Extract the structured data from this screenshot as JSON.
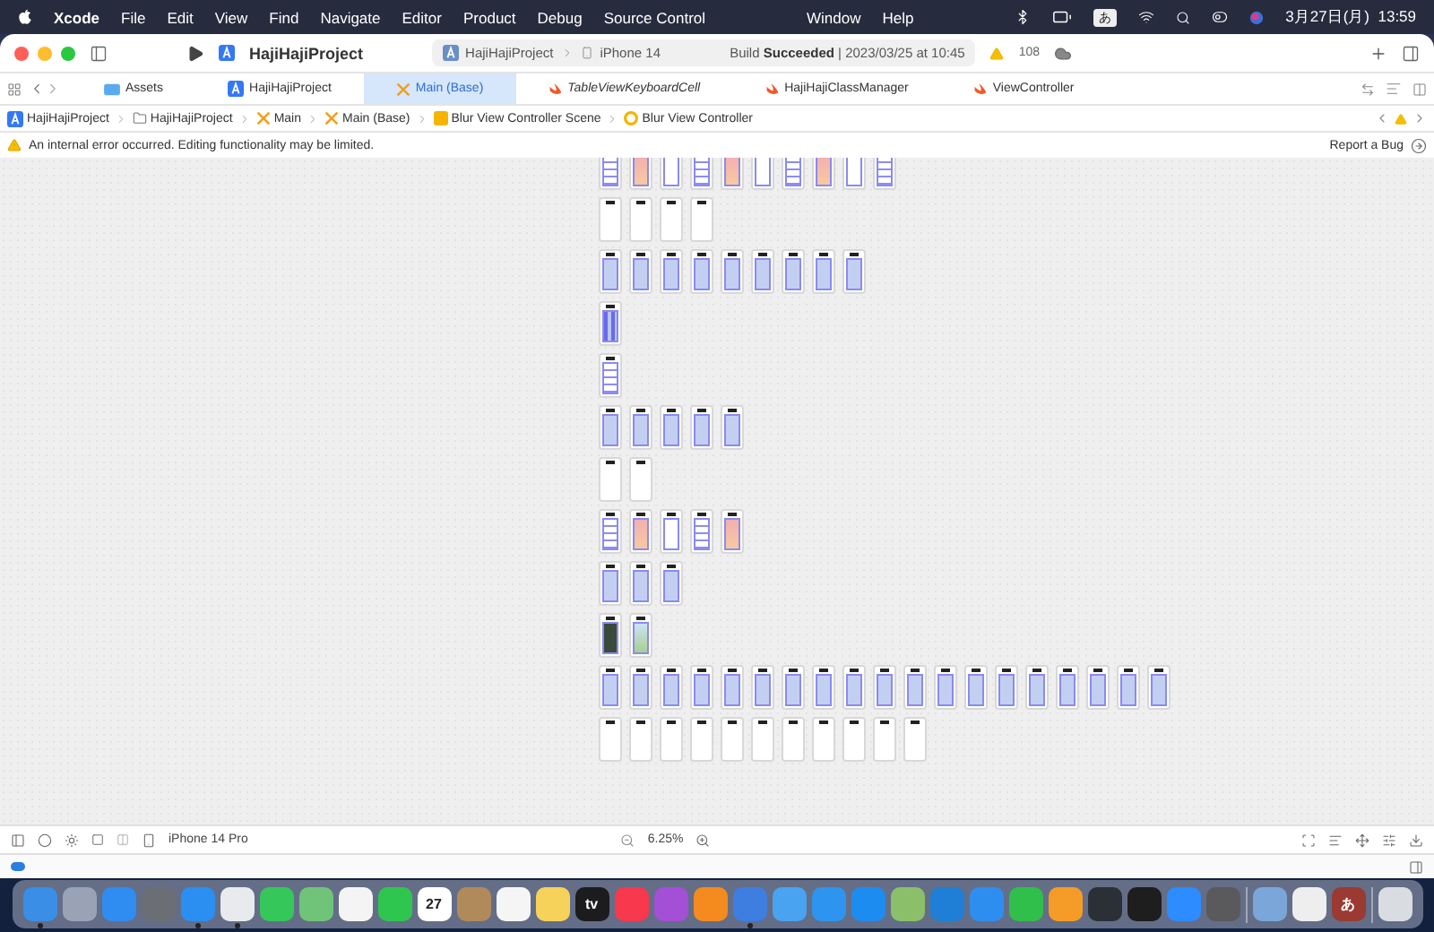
{
  "menu_bar": {
    "app": "Xcode",
    "menus": [
      "File",
      "Edit",
      "View",
      "Find",
      "Navigate",
      "Editor",
      "Product",
      "Debug",
      "Source Control"
    ],
    "right_menus": [
      "Window",
      "Help"
    ],
    "input_mode": "あ",
    "clock": "3月27日(月)  13:59"
  },
  "toolbar": {
    "project": "HajiHajiProject",
    "scheme": "HajiHajiProject",
    "device": "iPhone 14",
    "status": "Build **Succeeded** | 2023/03/25 at 10:45",
    "warnings": "108"
  },
  "tabs": [
    {
      "label": "Assets",
      "kind": "assets",
      "selected": false,
      "preview": false
    },
    {
      "label": "HajiHajiProject",
      "kind": "project",
      "selected": false,
      "preview": false
    },
    {
      "label": "Main (Base)",
      "kind": "storyboard",
      "selected": true,
      "preview": false
    },
    {
      "label": "TableViewKeyboardCell",
      "kind": "swift",
      "selected": false,
      "preview": true
    },
    {
      "label": "HajiHajiClassManager",
      "kind": "swift",
      "selected": false,
      "preview": false
    },
    {
      "label": "ViewController",
      "kind": "swift",
      "selected": false,
      "preview": false
    }
  ],
  "breadcrumb": [
    {
      "label": "HajiHajiProject",
      "kind": "project"
    },
    {
      "label": "HajiHajiProject",
      "kind": "folder"
    },
    {
      "label": "Main",
      "kind": "storyboard"
    },
    {
      "label": "Main (Base)",
      "kind": "storyboard"
    },
    {
      "label": "Blur View Controller Scene",
      "kind": "scene"
    },
    {
      "label": "Blur View Controller",
      "kind": "controller"
    }
  ],
  "notice": {
    "message": "An internal error occurred. Editing functionality may be limited.",
    "action": "Report a Bug"
  },
  "bottom_bar": {
    "device": "iPhone 14 Pro",
    "zoom": "6.25%"
  },
  "debug_area": {
    "on": true
  },
  "dock": [
    {
      "kind": "app",
      "color": "#3a8ee6",
      "running": true
    },
    {
      "kind": "app",
      "color": "#9aa3b5",
      "running": false
    },
    {
      "kind": "app",
      "color": "#2f8cf0",
      "running": false
    },
    {
      "kind": "app",
      "color": "#6b6e75",
      "running": false
    },
    {
      "kind": "app",
      "color": "#2b8ff2",
      "running": true
    },
    {
      "kind": "app",
      "color": "#e8eaed",
      "running": true
    },
    {
      "kind": "app",
      "color": "#35c759",
      "running": false
    },
    {
      "kind": "app",
      "color": "#6fc47a",
      "running": false
    },
    {
      "kind": "app",
      "color": "#f4f4f4",
      "running": false
    },
    {
      "kind": "app",
      "color": "#2fc650",
      "running": false
    },
    {
      "kind": "app",
      "color": "#ffffff",
      "running": false,
      "label": "27"
    },
    {
      "kind": "app",
      "color": "#b08a5a",
      "running": false
    },
    {
      "kind": "app",
      "color": "#f5f5f5",
      "running": false
    },
    {
      "kind": "app",
      "color": "#f6d25a",
      "running": false
    },
    {
      "kind": "app",
      "color": "#1c1c1e",
      "running": false,
      "label": "tv"
    },
    {
      "kind": "app",
      "color": "#f7384d",
      "running": false
    },
    {
      "kind": "app",
      "color": "#a34fd6",
      "running": false
    },
    {
      "kind": "app",
      "color": "#f58a1f",
      "running": false
    },
    {
      "kind": "app",
      "color": "#3d7ee0",
      "running": true
    },
    {
      "kind": "app",
      "color": "#4aa3f0",
      "running": false
    },
    {
      "kind": "app",
      "color": "#2d95ef",
      "running": false
    },
    {
      "kind": "app",
      "color": "#1d8cf0",
      "running": false
    },
    {
      "kind": "app",
      "color": "#8cbf6a",
      "running": false
    },
    {
      "kind": "app",
      "color": "#1f7ed6",
      "running": false
    },
    {
      "kind": "app",
      "color": "#2e8ef0",
      "running": false
    },
    {
      "kind": "app",
      "color": "#2fbf4a",
      "running": false
    },
    {
      "kind": "app",
      "color": "#f59c28",
      "running": false
    },
    {
      "kind": "app",
      "color": "#2b3036",
      "running": false
    },
    {
      "kind": "app",
      "color": "#1e1e1e",
      "running": false
    },
    {
      "kind": "app",
      "color": "#2d8cff",
      "running": false
    },
    {
      "kind": "app",
      "color": "#5a5a5c",
      "running": false
    },
    {
      "kind": "separator"
    },
    {
      "kind": "app",
      "color": "#7aa6d9",
      "running": false
    },
    {
      "kind": "app",
      "color": "#eeeeee",
      "running": false
    },
    {
      "kind": "app",
      "color": "#9b3a32",
      "running": false,
      "label": "あ"
    },
    {
      "kind": "separator"
    },
    {
      "kind": "trash",
      "color": "#d9dde2",
      "running": false
    }
  ]
}
